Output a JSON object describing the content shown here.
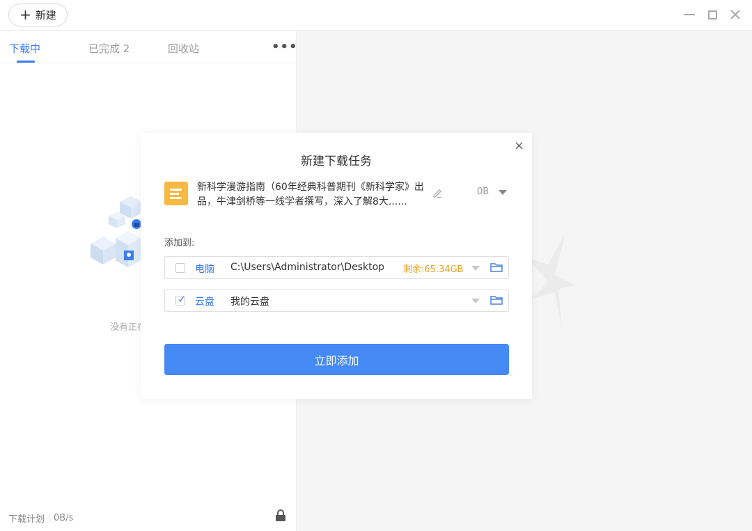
{
  "titlebar": {
    "new_label": "新建"
  },
  "tabs": [
    {
      "label": "下载中",
      "active": true
    },
    {
      "label": "已完成 2",
      "active": false
    },
    {
      "label": "回收站",
      "active": false
    }
  ],
  "more_label": "•••",
  "empty": {
    "text": "没有正在下载的任务"
  },
  "footer": {
    "plan_label": "下载计划",
    "speed": "0B/s"
  },
  "dialog": {
    "title": "新建下载任务",
    "close_label": "×",
    "file": {
      "name": "新科学漫游指南（60年经典科普期刊《新科学家》出品，牛津剑桥等一线学者撰写，深入了解8大......",
      "size": "0B"
    },
    "add_to_label": "添加到:",
    "destinations": [
      {
        "name": "电脑",
        "path": "C:\\Users\\Administrator\\Desktop",
        "free": "剩余:65.34GB",
        "checked": false
      },
      {
        "name": "云盘",
        "path": "我的云盘",
        "free": "",
        "checked": true
      }
    ],
    "confirm_label": "立即添加"
  },
  "colors": {
    "accent": "#3c7cf4",
    "button": "#4589f5",
    "warning": "#e8a524",
    "file_icon": "#f9b83f"
  }
}
